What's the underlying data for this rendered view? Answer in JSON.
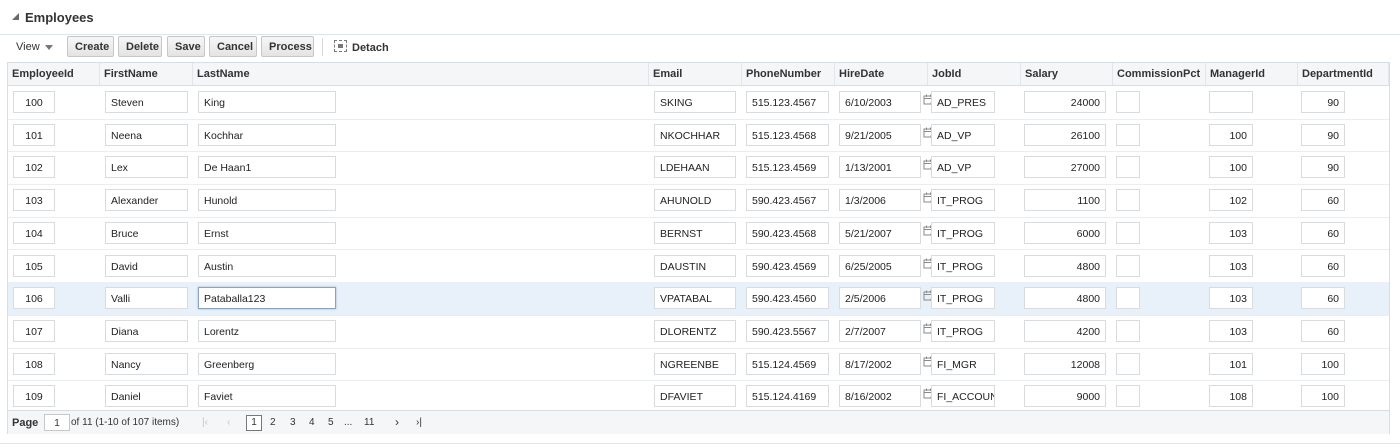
{
  "panel": {
    "title": "Employees"
  },
  "toolbar": {
    "view_label": "View",
    "buttons": [
      "Create",
      "Delete",
      "Save",
      "Cancel",
      "Process"
    ],
    "detach_label": "Detach"
  },
  "table": {
    "columns": [
      "EmployeeId",
      "FirstName",
      "LastName",
      "Email",
      "PhoneNumber",
      "HireDate",
      "JobId",
      "Salary",
      "CommissionPct",
      "ManagerId",
      "DepartmentId"
    ],
    "rows": [
      {
        "id": "100",
        "first": "Steven",
        "last": "King",
        "email": "SKING",
        "phone": "515.123.4567",
        "hire": "6/10/2003",
        "job": "AD_PRES",
        "salary": "24000",
        "comm": "",
        "manager": "",
        "dept": "90"
      },
      {
        "id": "101",
        "first": "Neena",
        "last": "Kochhar",
        "email": "NKOCHHAR",
        "phone": "515.123.4568",
        "hire": "9/21/2005",
        "job": "AD_VP",
        "salary": "26100",
        "comm": "",
        "manager": "100",
        "dept": "90"
      },
      {
        "id": "102",
        "first": "Lex",
        "last": "De Haan1",
        "email": "LDEHAAN",
        "phone": "515.123.4569",
        "hire": "1/13/2001",
        "job": "AD_VP",
        "salary": "27000",
        "comm": "",
        "manager": "100",
        "dept": "90"
      },
      {
        "id": "103",
        "first": "Alexander",
        "last": "Hunold",
        "email": "AHUNOLD",
        "phone": "590.423.4567",
        "hire": "1/3/2006",
        "job": "IT_PROG",
        "salary": "1100",
        "comm": "",
        "manager": "102",
        "dept": "60"
      },
      {
        "id": "104",
        "first": "Bruce",
        "last": "Ernst",
        "email": "BERNST",
        "phone": "590.423.4568",
        "hire": "5/21/2007",
        "job": "IT_PROG",
        "salary": "6000",
        "comm": "",
        "manager": "103",
        "dept": "60"
      },
      {
        "id": "105",
        "first": "David",
        "last": "Austin",
        "email": "DAUSTIN",
        "phone": "590.423.4569",
        "hire": "6/25/2005",
        "job": "IT_PROG",
        "salary": "4800",
        "comm": "",
        "manager": "103",
        "dept": "60"
      },
      {
        "id": "106",
        "first": "Valli",
        "last": "Pataballa123",
        "email": "VPATABAL",
        "phone": "590.423.4560",
        "hire": "2/5/2006",
        "job": "IT_PROG",
        "salary": "4800",
        "comm": "",
        "manager": "103",
        "dept": "60"
      },
      {
        "id": "107",
        "first": "Diana",
        "last": "Lorentz",
        "email": "DLORENTZ",
        "phone": "590.423.5567",
        "hire": "2/7/2007",
        "job": "IT_PROG",
        "salary": "4200",
        "comm": "",
        "manager": "103",
        "dept": "60"
      },
      {
        "id": "108",
        "first": "Nancy",
        "last": "Greenberg",
        "email": "NGREENBE",
        "phone": "515.124.4569",
        "hire": "8/17/2002",
        "job": "FI_MGR",
        "salary": "12008",
        "comm": "",
        "manager": "101",
        "dept": "100"
      },
      {
        "id": "109",
        "first": "Daniel",
        "last": "Faviet",
        "email": "DFAVIET",
        "phone": "515.124.4169",
        "hire": "8/16/2002",
        "job": "FI_ACCOUN",
        "salary": "9000",
        "comm": "",
        "manager": "108",
        "dept": "100"
      }
    ],
    "selected_row": 6
  },
  "pagination": {
    "page_label": "Page",
    "current_page": "1",
    "summary": "of 11 (1-10 of 107 items)",
    "pages": [
      "1",
      "2",
      "3",
      "4",
      "5",
      "...",
      "11"
    ],
    "first_icon": "first-page-icon",
    "prev_icon": "prev-page-icon",
    "next_icon": "next-page-icon",
    "last_icon": "last-page-icon"
  }
}
